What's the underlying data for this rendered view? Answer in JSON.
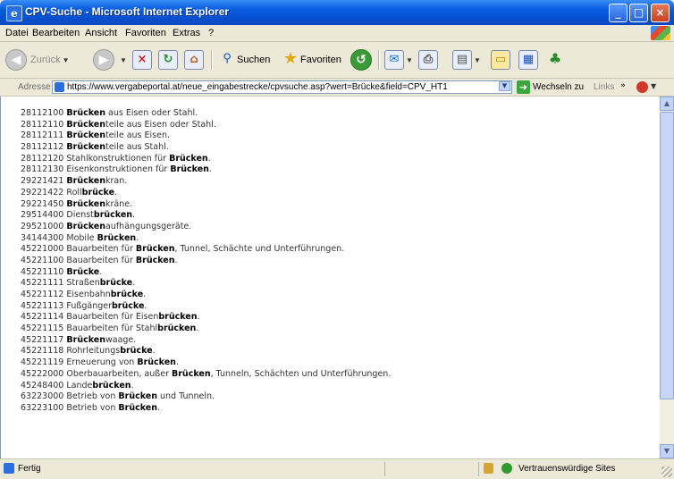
{
  "window": {
    "title": "CPV-Suche - Microsoft Internet Explorer"
  },
  "menu": [
    "Datei",
    "Bearbeiten",
    "Ansicht",
    "Favoriten",
    "Extras",
    "?"
  ],
  "toolbar": {
    "back": "Zurück",
    "search": "Suchen",
    "favorites": "Favoriten"
  },
  "address": {
    "label": "Adresse",
    "url": "https://www.vergabeportal.at/neue_eingabestrecke/cpvsuche.asp?wert=Brücke&field=CPV_HT1",
    "go_label": "Wechseln zu",
    "links_label": "Links"
  },
  "results": [
    {
      "code": "28112100",
      "pre": "",
      "bold": "Brücken",
      "post": " aus Eisen oder Stahl."
    },
    {
      "code": "28112110",
      "pre": "",
      "bold": "Brücken",
      "post": "teile aus Eisen oder Stahl."
    },
    {
      "code": "28112111",
      "pre": "",
      "bold": "Brücken",
      "post": "teile aus Eisen."
    },
    {
      "code": "28112112",
      "pre": "",
      "bold": "Brücken",
      "post": "teile aus Stahl."
    },
    {
      "code": "28112120",
      "pre": "Stahlkonstruktionen für ",
      "bold": "Brücken",
      "post": "."
    },
    {
      "code": "28112130",
      "pre": "Eisenkonstruktionen für ",
      "bold": "Brücken",
      "post": "."
    },
    {
      "code": "29221421",
      "pre": "",
      "bold": "Brücken",
      "post": "kran."
    },
    {
      "code": "29221422",
      "pre": "Roll",
      "bold": "brücke",
      "post": "."
    },
    {
      "code": "29221450",
      "pre": "",
      "bold": "Brücken",
      "post": "kräne."
    },
    {
      "code": "29514400",
      "pre": "Dienst",
      "bold": "brücken",
      "post": "."
    },
    {
      "code": "29521000",
      "pre": "",
      "bold": "Brücken",
      "post": "aufhängungsgeräte."
    },
    {
      "code": "34144300",
      "pre": "Mobile ",
      "bold": "Brücken",
      "post": "."
    },
    {
      "code": "45221000",
      "pre": "Bauarbeiten für ",
      "bold": "Brücken",
      "post": ", Tunnel, Schächte und Unterführungen."
    },
    {
      "code": "45221100",
      "pre": "Bauarbeiten für ",
      "bold": "Brücken",
      "post": "."
    },
    {
      "code": "45221110",
      "pre": "",
      "bold": "Brücke",
      "post": "."
    },
    {
      "code": "45221111",
      "pre": "Straßen",
      "bold": "brücke",
      "post": "."
    },
    {
      "code": "45221112",
      "pre": "Eisenbahn",
      "bold": "brücke",
      "post": "."
    },
    {
      "code": "45221113",
      "pre": "Fußgänger",
      "bold": "brücke",
      "post": "."
    },
    {
      "code": "45221114",
      "pre": "Bauarbeiten für Eisen",
      "bold": "brücken",
      "post": "."
    },
    {
      "code": "45221115",
      "pre": "Bauarbeiten für Stahl",
      "bold": "brücken",
      "post": "."
    },
    {
      "code": "45221117",
      "pre": "",
      "bold": "Brücken",
      "post": "waage."
    },
    {
      "code": "45221118",
      "pre": "Rohrleitungs",
      "bold": "brücke",
      "post": "."
    },
    {
      "code": "45221119",
      "pre": "Erneuerung von ",
      "bold": "Brücken",
      "post": "."
    },
    {
      "code": "45222000",
      "pre": "Oberbauarbeiten, außer ",
      "bold": "Brücken",
      "post": ", Tunneln, Schächten und Unterführungen."
    },
    {
      "code": "45248400",
      "pre": "Lande",
      "bold": "brücken",
      "post": "."
    },
    {
      "code": "63223000",
      "pre": "Betrieb von ",
      "bold": "Brücken",
      "post": " und Tunneln."
    },
    {
      "code": "63223100",
      "pre": "Betrieb von ",
      "bold": "Brücken",
      "post": "."
    }
  ],
  "status": {
    "text": "Fertig",
    "zone": "Vertrauenswürdige Sites"
  }
}
